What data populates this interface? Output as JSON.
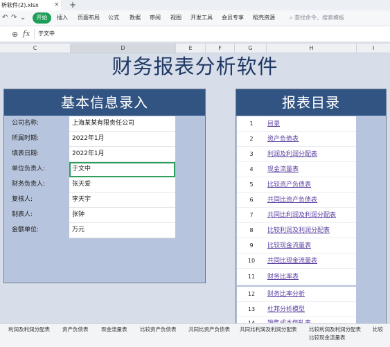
{
  "window": {
    "file_tab": "析软件(2).xlsx",
    "close_glyph": "×",
    "new_tab_glyph": "+"
  },
  "quick_icons": {
    "undo": "↶",
    "redo": "↷",
    "more": "⌄"
  },
  "menu": {
    "items": [
      "开始",
      "插入",
      "页面布局",
      "公式",
      "数据",
      "审阅",
      "视图",
      "开发工具",
      "会员专享",
      "稻壳资源"
    ],
    "search_placeholder": "查找命令、搜索模板",
    "search_glyph": "⌕"
  },
  "formula_bar": {
    "zoom_glyph": "⊕",
    "fx": "fx",
    "content": "于文中"
  },
  "columns": [
    "C",
    "D",
    "E",
    "F",
    "G",
    "H",
    "I"
  ],
  "main_title": "财务报表分析软件",
  "left_panel": {
    "title": "基本信息录入",
    "rows": [
      {
        "label": "公司名称:",
        "value": "上海某某有限责任公司"
      },
      {
        "label": "所属时期:",
        "value": "2022年1月"
      },
      {
        "label": "填表日期:",
        "value": "2022年1月"
      },
      {
        "label": "单位负责人:",
        "value": "于文中"
      },
      {
        "label": "财务负责人:",
        "value": "张天爱"
      },
      {
        "label": "复核人:",
        "value": "李天宇"
      },
      {
        "label": "制表人:",
        "value": "张钟"
      },
      {
        "label": "金额单位:",
        "value": "万元"
      }
    ]
  },
  "right_panel": {
    "title": "报表目录",
    "rows": [
      {
        "num": "1",
        "label": "目录"
      },
      {
        "num": "2",
        "label": "资产负债表"
      },
      {
        "num": "3",
        "label": "利润及利润分配表"
      },
      {
        "num": "4",
        "label": "现金流量表"
      },
      {
        "num": "5",
        "label": "比较资产负债表"
      },
      {
        "num": "6",
        "label": "共同比资产负债表"
      },
      {
        "num": "7",
        "label": "共同比利润及利润分配表"
      },
      {
        "num": "8",
        "label": "比较利润及利润分配表"
      },
      {
        "num": "9",
        "label": "比较现金流量表"
      },
      {
        "num": "10",
        "label": "共同比现金流量表"
      },
      {
        "num": "11",
        "label": "财务比率表"
      },
      {
        "num": "12",
        "label": "财务比率分析"
      },
      {
        "num": "13",
        "label": "杜邦分析模型"
      },
      {
        "num": "14",
        "label": "销售成本倒轧表"
      }
    ]
  },
  "sheet_tabs": [
    "利润及利润分配表",
    "资产负债表",
    "现金流量表",
    "比较资产负债表",
    "共同比资产负债表",
    "共同比利润及利润分配表",
    "比较利润及利润分配表",
    "比较现金流量表",
    "比较"
  ],
  "colors": {
    "header_fill": "#325483",
    "panel_fill": "#b7c4dd",
    "accent_green": "#1e9e59",
    "link": "#5b3fa0",
    "title_text": "#1f3864"
  }
}
